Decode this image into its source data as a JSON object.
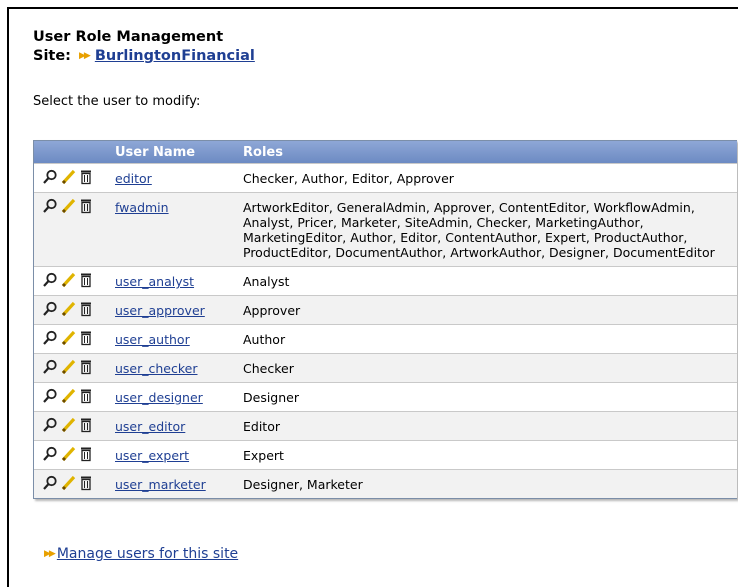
{
  "header": {
    "title": "User Role Management",
    "site_label": "Site:",
    "site_name": "BurlingtonFinancial"
  },
  "prompt": "Select the user to modify:",
  "table": {
    "columns": [
      "User Name",
      "Roles"
    ],
    "rows": [
      {
        "user": "editor",
        "roles": "Checker, Author, Editor, Approver"
      },
      {
        "user": "fwadmin",
        "roles": "ArtworkEditor, GeneralAdmin, Approver, ContentEditor, WorkflowAdmin, Analyst, Pricer, Marketer, SiteAdmin, Checker, MarketingAuthor, MarketingEditor, Author, Editor, ContentAuthor, Expert, ProductAuthor, ProductEditor, DocumentAuthor, ArtworkAuthor, Designer, DocumentEditor"
      },
      {
        "user": "user_analyst",
        "roles": "Analyst"
      },
      {
        "user": "user_approver",
        "roles": "Approver"
      },
      {
        "user": "user_author",
        "roles": "Author"
      },
      {
        "user": "user_checker",
        "roles": "Checker"
      },
      {
        "user": "user_designer",
        "roles": "Designer"
      },
      {
        "user": "user_editor",
        "roles": "Editor"
      },
      {
        "user": "user_expert",
        "roles": "Expert"
      },
      {
        "user": "user_marketer",
        "roles": "Designer, Marketer"
      }
    ],
    "row_icons": [
      "inspect-icon",
      "edit-pencil-icon",
      "delete-trash-icon"
    ]
  },
  "footer": {
    "manage_link": "Manage users for this site"
  },
  "colors": {
    "header_bar": "#6b89c2",
    "link": "#1f3f93",
    "arrow": "#e8a000"
  }
}
